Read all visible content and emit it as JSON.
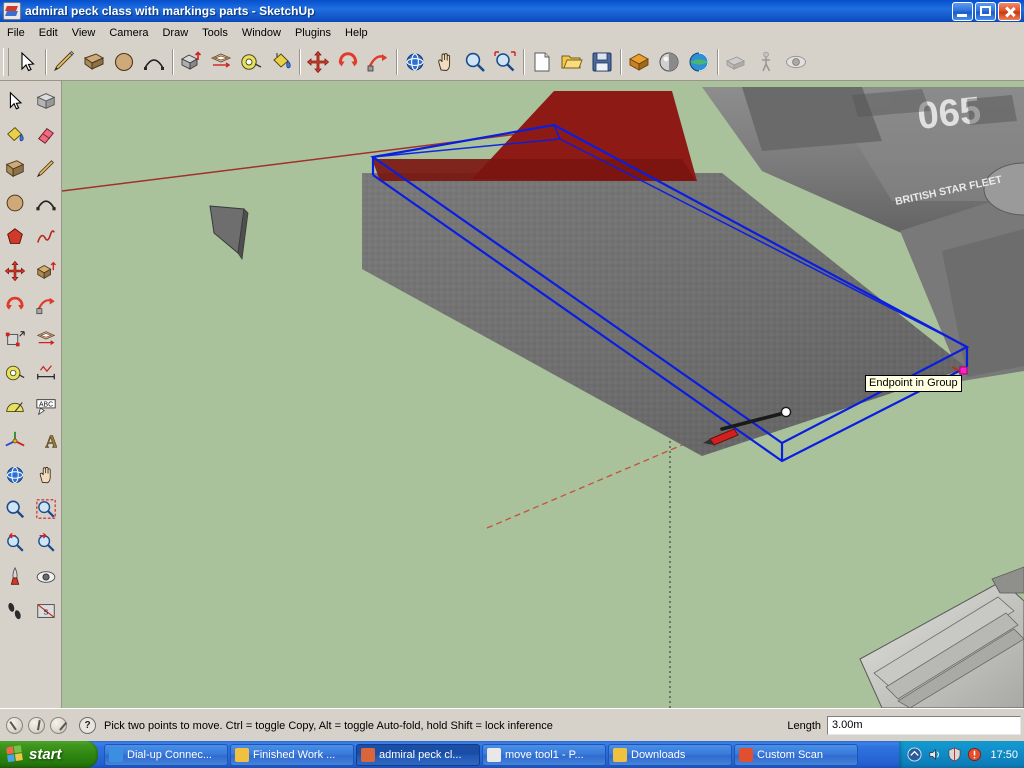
{
  "window": {
    "title": "admiral peck class with markings parts - SketchUp",
    "app_icon": "sketchup-icon",
    "buttons": [
      {
        "name": "minimize-button",
        "glyph": "minimize-icon"
      },
      {
        "name": "maximize-button",
        "glyph": "maximize-icon"
      },
      {
        "name": "close-button",
        "glyph": "close-icon"
      }
    ]
  },
  "menubar": {
    "items": [
      {
        "label": "File"
      },
      {
        "label": "Edit"
      },
      {
        "label": "View"
      },
      {
        "label": "Camera"
      },
      {
        "label": "Draw"
      },
      {
        "label": "Tools"
      },
      {
        "label": "Window"
      },
      {
        "label": "Plugins"
      },
      {
        "label": "Help"
      }
    ]
  },
  "toolbar": {
    "groups": [
      {
        "name": "standard",
        "buttons": [
          {
            "name": "select-tool",
            "icon": "arrow-cursor-icon"
          },
          {
            "name": "eraser-tool",
            "icon": "eraser-icon"
          },
          {
            "name": "line-tool",
            "icon": "pencil-icon"
          },
          {
            "name": "rectangle-tool",
            "icon": "rectangle-icon"
          },
          {
            "name": "circle-tool",
            "icon": "circle-icon"
          },
          {
            "name": "arc-tool",
            "icon": "arc-icon"
          }
        ]
      },
      {
        "name": "modify",
        "buttons": [
          {
            "name": "pushpull-tool",
            "icon": "pushpull-icon"
          },
          {
            "name": "offset-tool",
            "icon": "offset-icon"
          },
          {
            "name": "tape-measure-tool",
            "icon": "tape-measure-icon"
          },
          {
            "name": "paint-bucket-tool",
            "icon": "paint-bucket-icon"
          },
          {
            "name": "move-tool",
            "icon": "move-cross-icon"
          },
          {
            "name": "rotate-tool",
            "icon": "rotate-icon"
          },
          {
            "name": "scale-tool",
            "icon": "scale-icon"
          }
        ]
      },
      {
        "name": "camera",
        "buttons": [
          {
            "name": "orbit-tool",
            "icon": "orbit-icon"
          },
          {
            "name": "pan-tool",
            "icon": "hand-icon"
          },
          {
            "name": "zoom-tool",
            "icon": "magnifier-icon"
          },
          {
            "name": "zoom-extents-tool",
            "icon": "zoom-extents-icon"
          }
        ]
      },
      {
        "name": "file",
        "buttons": [
          {
            "name": "new-button",
            "icon": "new-document-icon"
          },
          {
            "name": "open-button",
            "icon": "open-folder-icon"
          },
          {
            "name": "save-button",
            "icon": "save-disk-icon"
          }
        ]
      },
      {
        "name": "construction",
        "buttons": [
          {
            "name": "components-button",
            "icon": "components-icon"
          },
          {
            "name": "materials-button",
            "icon": "materials-icon"
          },
          {
            "name": "styles-button",
            "icon": "styles-sphere-icon"
          }
        ]
      },
      {
        "name": "walkthrough",
        "buttons": [
          {
            "name": "position-camera-tool",
            "icon": "position-camera-icon"
          },
          {
            "name": "walk-tool",
            "icon": "walk-icon"
          },
          {
            "name": "look-around-tool",
            "icon": "look-around-icon"
          }
        ]
      }
    ]
  },
  "large_tool_set": {
    "rows": [
      [
        {
          "name": "select-tool",
          "icon": "arrow-cursor-icon"
        },
        {
          "name": "make-component-tool",
          "icon": "make-component-icon"
        }
      ],
      [
        {
          "name": "paint-bucket-tool",
          "icon": "paint-bucket-icon"
        },
        {
          "name": "eraser-tool",
          "icon": "eraser-icon"
        }
      ],
      [
        {
          "name": "rectangle-tool",
          "icon": "rectangle-icon"
        },
        {
          "name": "line-tool",
          "icon": "pencil-icon"
        }
      ],
      [
        {
          "name": "circle-tool",
          "icon": "circle-icon"
        },
        {
          "name": "arc-tool",
          "icon": "arc-icon"
        }
      ],
      [
        {
          "name": "polygon-tool",
          "icon": "polygon-icon"
        },
        {
          "name": "freehand-tool",
          "icon": "freehand-icon"
        }
      ],
      [
        {
          "name": "move-tool",
          "icon": "move-cross-icon"
        },
        {
          "name": "pushpull-tool",
          "icon": "pushpull-icon"
        }
      ],
      [
        {
          "name": "rotate-tool",
          "icon": "rotate-icon"
        },
        {
          "name": "follow-me-tool",
          "icon": "follow-me-icon"
        }
      ],
      [
        {
          "name": "scale-tool",
          "icon": "scale-icon"
        },
        {
          "name": "offset-tool",
          "icon": "offset-icon"
        }
      ],
      [
        {
          "name": "tape-measure-tool",
          "icon": "tape-measure-icon"
        },
        {
          "name": "dimension-tool",
          "icon": "dimension-icon"
        }
      ],
      [
        {
          "name": "protractor-tool",
          "icon": "protractor-icon"
        },
        {
          "name": "text-tool",
          "icon": "text-abc-icon"
        }
      ],
      [
        {
          "name": "axes-tool",
          "icon": "axes-icon"
        },
        {
          "name": "3d-text-tool",
          "icon": "3d-text-icon"
        }
      ],
      [
        {
          "name": "orbit-tool",
          "icon": "orbit-icon"
        },
        {
          "name": "pan-tool",
          "icon": "hand-icon"
        }
      ],
      [
        {
          "name": "zoom-tool",
          "icon": "magnifier-icon"
        },
        {
          "name": "zoom-window-tool",
          "icon": "zoom-window-icon"
        }
      ],
      [
        {
          "name": "previous-view-tool",
          "icon": "previous-view-icon"
        },
        {
          "name": "next-view-tool",
          "icon": "next-view-icon"
        }
      ],
      [
        {
          "name": "position-camera-tool",
          "icon": "position-camera-icon"
        },
        {
          "name": "look-around-tool",
          "icon": "look-around-icon"
        }
      ],
      [
        {
          "name": "walk-tool",
          "icon": "walk-icon"
        },
        {
          "name": "section-plane-tool",
          "icon": "section-plane-icon"
        }
      ]
    ]
  },
  "viewport": {
    "background_color": "#a9c29b",
    "selection_color": "#0a32e6",
    "axis_red_color": "#c03020",
    "model_name": "admiral peck class",
    "decals": [
      {
        "name": "hull-number",
        "text": "065"
      },
      {
        "name": "fleet-marking",
        "text": "BRITISH STAR FLEET"
      }
    ],
    "tooltip": {
      "name": "inference-tooltip",
      "text": "Endpoint in Group"
    },
    "selected_group_label": "wing-group"
  },
  "statusbar": {
    "help_icon": "question-mark-icon",
    "message": "Pick two points to move.  Ctrl = toggle Copy, Alt = toggle Auto-fold, hold Shift = lock inference",
    "vcb": {
      "label": "Length",
      "value": "3.00m"
    },
    "gauges": [
      {
        "name": "status-gauge-1"
      },
      {
        "name": "status-gauge-2"
      },
      {
        "name": "status-gauge-3"
      }
    ]
  },
  "taskbar": {
    "start_label": "start",
    "tasks": [
      {
        "label": "Dial-up Connec...",
        "icon_color": "#3a8fe0",
        "active": false
      },
      {
        "label": "Finished Work ...",
        "icon_color": "#f0c040",
        "active": false
      },
      {
        "label": "admiral peck cl...",
        "icon_color": "#d8663a",
        "active": true
      },
      {
        "label": "move tool1 - P...",
        "icon_color": "#e8e8e8",
        "active": false
      },
      {
        "label": "Downloads",
        "icon_color": "#f0c040",
        "active": false
      },
      {
        "label": "Custom Scan",
        "icon_color": "#e05030",
        "active": false
      }
    ],
    "tray": {
      "icons": [
        {
          "name": "network-tray-icon"
        },
        {
          "name": "volume-tray-icon"
        },
        {
          "name": "shield-tray-icon"
        },
        {
          "name": "antivirus-tray-icon"
        }
      ],
      "clock": "17:50"
    }
  }
}
